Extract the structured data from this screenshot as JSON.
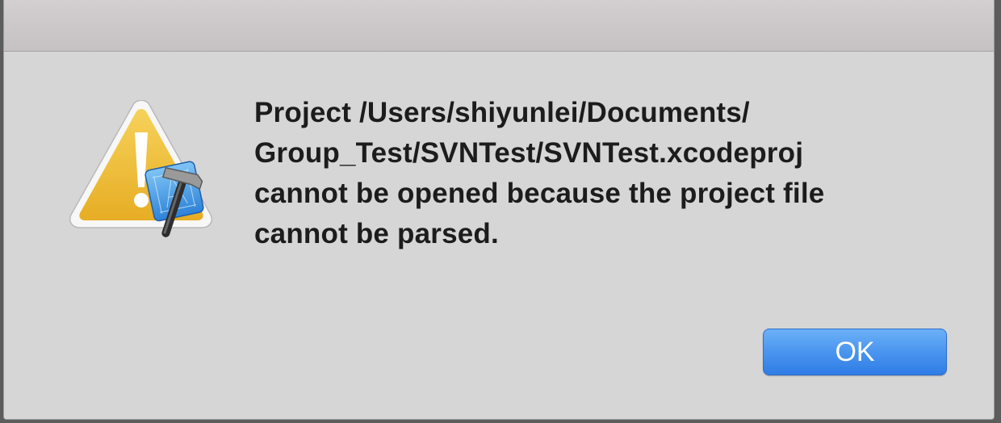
{
  "dialog": {
    "icon": "xcode-caution-icon",
    "message_lines": [
      "Project /Users/shiyunlei/Documents/",
      "Group_Test/SVNTest/SVNTest.xcodeproj",
      "cannot be opened because the project file",
      "cannot be parsed."
    ],
    "ok_label": "OK"
  },
  "colors": {
    "dialog_background": "#d6d6d6",
    "button_blue": "#4a95ef",
    "warning_yellow": "#f1c232",
    "text": "#1c1c1c"
  }
}
